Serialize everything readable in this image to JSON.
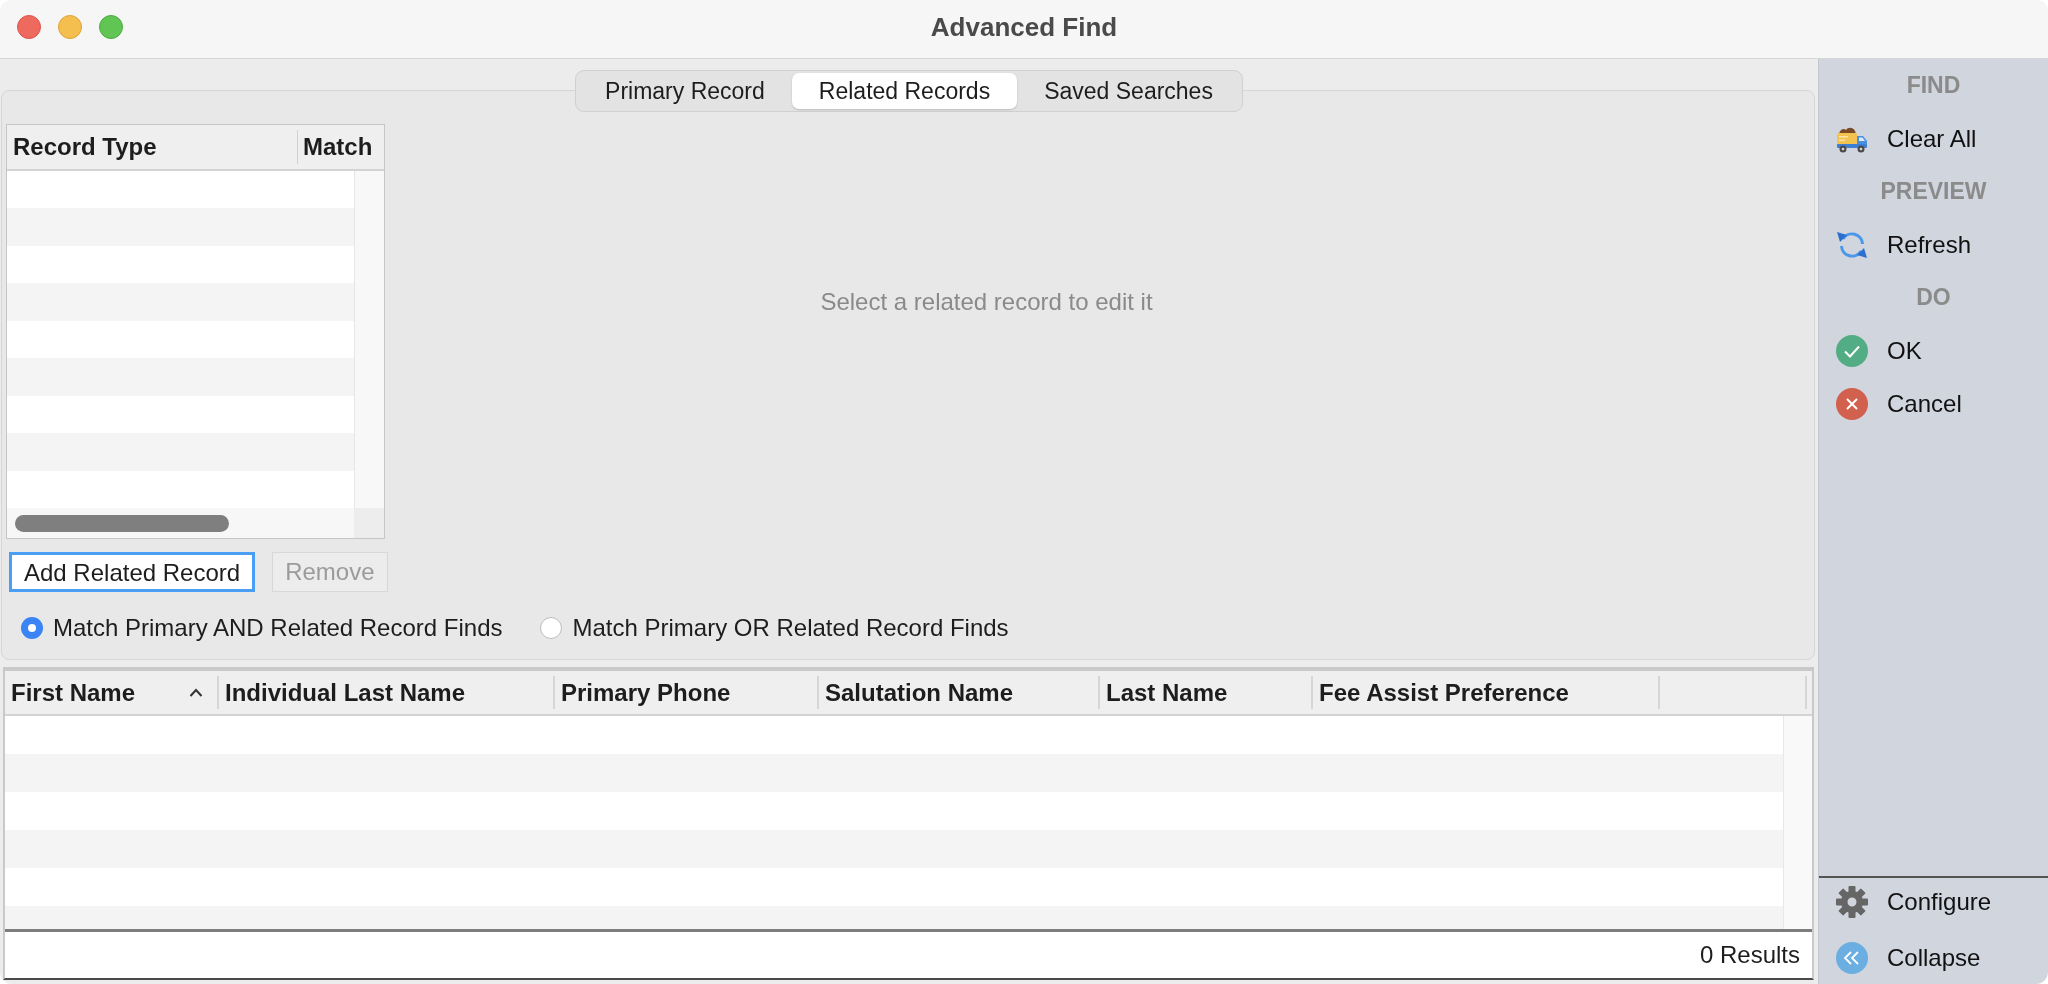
{
  "window": {
    "title": "Advanced Find"
  },
  "tabs": [
    {
      "label": "Primary Record",
      "selected": false
    },
    {
      "label": "Related Records",
      "selected": true
    },
    {
      "label": "Saved Searches",
      "selected": false
    }
  ],
  "related_table": {
    "columns": [
      "Record Type",
      "Match"
    ]
  },
  "detail_panel": {
    "message": "Select a related record to edit it"
  },
  "buttons": [
    {
      "label": "Add Related Record",
      "focused": true,
      "disabled": false
    },
    {
      "label": "Remove",
      "focused": false,
      "disabled": true
    }
  ],
  "match_options": [
    {
      "label": "Match Primary AND Related Record Finds",
      "selected": true
    },
    {
      "label": "Match Primary OR Related Record Finds",
      "selected": false
    }
  ],
  "results_table": {
    "columns": [
      {
        "label": "First Name",
        "sorted": true
      },
      {
        "label": "Individual Last Name",
        "sorted": false
      },
      {
        "label": "Primary Phone",
        "sorted": false
      },
      {
        "label": "Salutation Name",
        "sorted": false
      },
      {
        "label": "Last Name",
        "sorted": false
      },
      {
        "label": "Fee Assist Preference",
        "sorted": false
      }
    ]
  },
  "status_bar": {
    "text": "0 Results"
  },
  "sidebar": {
    "sections": [
      {
        "heading": "FIND",
        "items": [
          {
            "kind": "truck",
            "label": "Clear All"
          }
        ]
      },
      {
        "heading": "PREVIEW",
        "items": [
          {
            "kind": "refresh",
            "label": "Refresh"
          }
        ]
      },
      {
        "heading": "DO",
        "items": [
          {
            "kind": "ok",
            "label": "OK"
          },
          {
            "kind": "cancel",
            "label": "Cancel"
          }
        ]
      }
    ],
    "footer_items": [
      {
        "kind": "gear",
        "label": "Configure"
      },
      {
        "kind": "collapse",
        "label": "Collapse"
      }
    ]
  }
}
